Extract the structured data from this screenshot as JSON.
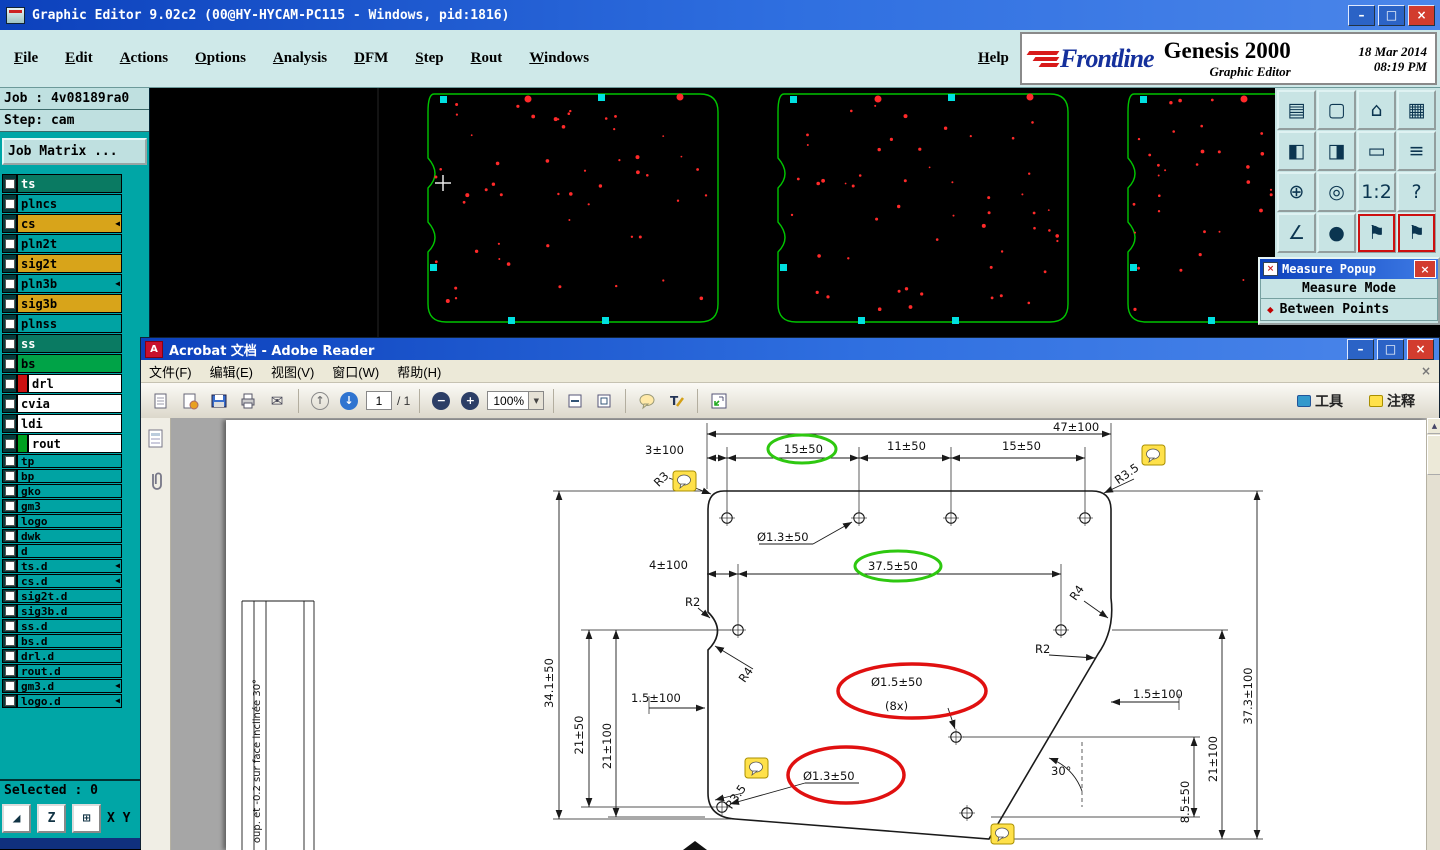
{
  "colors": {
    "titlebar_blue": "#0c41bc",
    "panel_teal": "#00a6a6",
    "layer_teal": "#00a3a3",
    "layer_gold": "#d8a41a",
    "highlight_green": "#2ec810",
    "highlight_red": "#e01010",
    "comment_yellow": "#ffe14a",
    "pcb_outline_green": "#00c400",
    "pcb_pad_cyan": "#00e0e0",
    "pcb_drill_red": "#ff2a2a"
  },
  "genesis": {
    "title": "Graphic Editor 9.02c2 (00@HY-HYCAM-PC115 - Windows, pid:1816)",
    "window_controls": [
      {
        "name": "minimize",
        "glyph": "–",
        "bg": "#2b63c6"
      },
      {
        "name": "maximize",
        "glyph": "□",
        "bg": "#2b63c6"
      },
      {
        "name": "close",
        "glyph": "×",
        "bg": "#d23c2e"
      }
    ],
    "menu": {
      "items": [
        {
          "label": "File"
        },
        {
          "label": "Edit"
        },
        {
          "label": "Actions"
        },
        {
          "label": "Options"
        },
        {
          "label": "Analysis"
        },
        {
          "label": "DFM"
        },
        {
          "label": "Step"
        },
        {
          "label": "Rout"
        },
        {
          "label": "Windows"
        }
      ],
      "help": "Help"
    },
    "brand": {
      "frontline": "Frontline",
      "product": "Genesis 2000",
      "date": "18 Mar 2014",
      "time": "08:19 PM",
      "subtitle": "Graphic Editor"
    },
    "job_label": "Job : 4v08189ra0",
    "step_label": "Step: cam",
    "job_matrix_label": "Job Matrix ...",
    "layers": [
      {
        "name": "ts",
        "bg": "#0a7a62",
        "fg": "#ffffff"
      },
      {
        "name": "plncs",
        "bg": "#00a3a3",
        "fg": "#000000"
      },
      {
        "name": "cs",
        "bg": "#d8a41a",
        "fg": "#000000",
        "arrow": true
      },
      {
        "name": "pln2t",
        "bg": "#00a3a3",
        "fg": "#000000"
      },
      {
        "name": "sig2t",
        "bg": "#d8a41a",
        "fg": "#000000"
      },
      {
        "name": "pln3b",
        "bg": "#00a3a3",
        "fg": "#000000",
        "arrow": true
      },
      {
        "name": "sig3b",
        "bg": "#d8a41a",
        "fg": "#000000"
      },
      {
        "name": "plnss",
        "bg": "#00a3a3",
        "fg": "#000000"
      },
      {
        "name": "ss",
        "bg": "#0a7a62",
        "fg": "#ffffff"
      },
      {
        "name": "bs",
        "bg": "#00a347",
        "fg": "#000000"
      },
      {
        "name": "drl",
        "bg": "#ffffff",
        "fg": "#000000",
        "chip": "#cc1111"
      },
      {
        "name": "cvia",
        "bg": "#ffffff",
        "fg": "#000000"
      },
      {
        "name": "ldi",
        "bg": "#ffffff",
        "fg": "#000000"
      },
      {
        "name": "rout",
        "bg": "#ffffff",
        "fg": "#000000",
        "chip": "#00a020"
      },
      {
        "name": "tp",
        "bg": "#00a3a3",
        "fg": "#000000"
      },
      {
        "name": "bp",
        "bg": "#00a3a3",
        "fg": "#000000"
      },
      {
        "name": "gko",
        "bg": "#00a3a3",
        "fg": "#000000"
      },
      {
        "name": "gm3",
        "bg": "#00a3a3",
        "fg": "#000000"
      },
      {
        "name": "logo",
        "bg": "#00a3a3",
        "fg": "#000000"
      },
      {
        "name": "dwk",
        "bg": "#00a3a3",
        "fg": "#000000"
      },
      {
        "name": "d",
        "bg": "#00a3a3",
        "fg": "#000000"
      },
      {
        "name": "ts.d",
        "bg": "#00a3a3",
        "fg": "#000000",
        "arrow": true
      },
      {
        "name": "cs.d",
        "bg": "#00a3a3",
        "fg": "#000000",
        "arrow": true
      },
      {
        "name": "sig2t.d",
        "bg": "#00a3a3",
        "fg": "#000000"
      },
      {
        "name": "sig3b.d",
        "bg": "#00a3a3",
        "fg": "#000000"
      },
      {
        "name": "ss.d",
        "bg": "#00a3a3",
        "fg": "#000000"
      },
      {
        "name": "bs.d",
        "bg": "#00a3a3",
        "fg": "#000000"
      },
      {
        "name": "drl.d",
        "bg": "#00a3a3",
        "fg": "#000000"
      },
      {
        "name": "rout.d",
        "bg": "#00a3a3",
        "fg": "#000000"
      },
      {
        "name": "gm3.d",
        "bg": "#00a3a3",
        "fg": "#000000",
        "arrow": true
      },
      {
        "name": "logo.d",
        "bg": "#00a3a3",
        "fg": "#000000",
        "arrow": true
      }
    ],
    "toolbar_buttons": [
      {
        "name": "export-page",
        "glyph": "▤"
      },
      {
        "name": "screen-view",
        "glyph": "▢"
      },
      {
        "name": "home-view",
        "glyph": "⌂"
      },
      {
        "name": "tile-windows",
        "glyph": "▦"
      },
      {
        "name": "zoom-in-view",
        "glyph": "◧"
      },
      {
        "name": "zoom-out-view",
        "glyph": "◨"
      },
      {
        "name": "clip-area",
        "glyph": "▭"
      },
      {
        "name": "layers-list",
        "glyph": "≡"
      },
      {
        "name": "fit-all",
        "glyph": "⊕"
      },
      {
        "name": "zoom-center",
        "glyph": "◎"
      },
      {
        "name": "scale-1-2",
        "glyph": "1:2",
        "small": true
      },
      {
        "name": "help",
        "glyph": "?"
      },
      {
        "name": "measure-tool",
        "glyph": "∠"
      },
      {
        "name": "snap-point",
        "glyph": "●"
      },
      {
        "name": "note-flag-1",
        "glyph": "⚑",
        "highlight": true
      },
      {
        "name": "note-flag-2",
        "glyph": "⚑",
        "highlight": true
      }
    ],
    "measure_popup": {
      "icon_glyph": "×",
      "title": "Measure Popup",
      "close_glyph": "×",
      "mode_header": "Measure Mode",
      "mode_value": "Between Points",
      "diamond_glyph": "◆"
    },
    "status": {
      "selected": "Selected : 0",
      "xy_label": "X Y :",
      "xy_buttons": [
        {
          "name": "pointer-tool",
          "glyph": "◢"
        },
        {
          "name": "zoom-tool",
          "glyph": "Z"
        },
        {
          "name": "grid-toggle",
          "glyph": "⊞"
        }
      ]
    }
  },
  "acrobat": {
    "title": "Acrobat 文档 - Adobe Reader",
    "window_controls": [
      {
        "name": "minimize",
        "glyph": "–",
        "bg": "#2b63c6"
      },
      {
        "name": "maximize",
        "glyph": "□",
        "bg": "#2b63c6"
      },
      {
        "name": "close",
        "glyph": "×",
        "bg": "#d23c2e"
      }
    ],
    "menu_items": [
      {
        "label": "文件(F)"
      },
      {
        "label": "编辑(E)"
      },
      {
        "label": "视图(V)"
      },
      {
        "label": "窗口(W)"
      },
      {
        "label": "帮助(H)"
      }
    ],
    "menu_close_glyph": "×",
    "toolbar": {
      "page_value": "1",
      "page_total": "/ 1",
      "zoom_value": "100%",
      "tools_label": "工具",
      "comment_label": "注释"
    },
    "drawing": {
      "dim_47": "47±100",
      "dim_3": "3±100",
      "dim_15a": "15±50",
      "dim_11": "11±50",
      "dim_15b": "15±50",
      "dia_13_top": "Ø1.3±50",
      "dim_4": "4±100",
      "dim_37_5": "37.5±50",
      "r2_left": "R2",
      "r4_left": "R4",
      "dim_34_1": "34.1±50",
      "dim_21_50": "21±50",
      "dim_21_100_left": "21±100",
      "dim_1_5_left": "1.5±100",
      "dia_15": "Ø1.5±50",
      "count_8x": "(8x)",
      "dia_13_bottom": "Ø1.3±50",
      "r35_bottom_left": "R3.5",
      "r3_top_left": "R3",
      "r35_top_right": "R3.5",
      "r4_right": "R4",
      "r2_right": "R2",
      "dim_1_5_right": "1.5±100",
      "dim_37_3": "37.3±100",
      "dim_21_100_right": "21±100",
      "dim_8_5": "8.5±50",
      "angle_30": "30°",
      "note_vertical": "oup. et -0.2 sur face inclinée 30°"
    }
  }
}
